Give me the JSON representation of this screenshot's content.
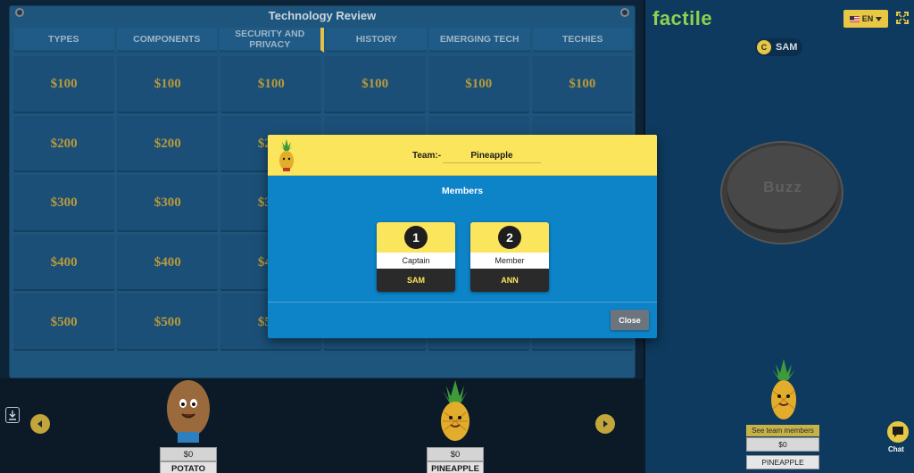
{
  "board": {
    "title": "Technology Review",
    "categories": [
      "TYPES",
      "COMPONENTS",
      "SECURITY AND PRIVACY",
      "HISTORY",
      "EMERGING TECH",
      "TECHIES"
    ],
    "values": [
      "$100",
      "$200",
      "$300",
      "$400",
      "$500"
    ]
  },
  "teams": [
    {
      "score": "$0",
      "name": "POTATO"
    },
    {
      "score": "$0",
      "name": "PINEAPPLE"
    }
  ],
  "right_panel": {
    "logo": "factile",
    "language": "EN",
    "player": {
      "badge": "C",
      "name": "SAM"
    },
    "buzz_label": "Buzz",
    "see_members_label": "See team members",
    "team_score": "$0",
    "team_name": "PINEAPPLE",
    "chat_label": "Chat"
  },
  "modal": {
    "team_label": "Team:-",
    "team_name": "Pineapple",
    "members_title": "Members",
    "members": [
      {
        "number": "1",
        "role": "Captain",
        "name": "SAM"
      },
      {
        "number": "2",
        "role": "Member",
        "name": "ANN"
      }
    ],
    "close_label": "Close"
  },
  "colors": {
    "board": "#1e557c",
    "tile_text": "#b89a3c",
    "accent_yellow": "#fbe55c",
    "modal_blue": "#0d83c8",
    "logo_green": "#8fd14f"
  }
}
